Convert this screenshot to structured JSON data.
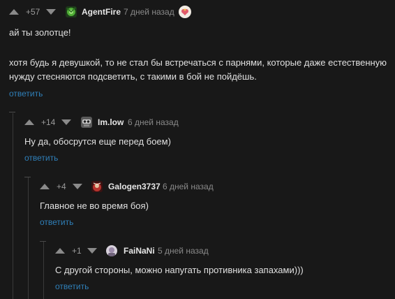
{
  "comments": [
    {
      "rating": "+57",
      "author": "AgentFire",
      "time": "7 дней назад",
      "lines": [
        "ай ты золотце!",
        "",
        "хотя будь я девушкой, то не стал бы встречаться с парнями, которые даже естественную",
        "нужду стесняются подсветить, с такими в бой не пойдёшь."
      ],
      "reply": "ответить"
    },
    {
      "rating": "+14",
      "author": "Im.low",
      "time": "6 дней назад",
      "lines": [
        "Ну да, обосрутся еще перед боем)"
      ],
      "reply": "ответить"
    },
    {
      "rating": "+4",
      "author": "Galogen3737",
      "time": "6 дней назад",
      "lines": [
        "Главное не во время боя)"
      ],
      "reply": "ответить"
    },
    {
      "rating": "+1",
      "author": "FaiNaNi",
      "time": "5 дней назад",
      "lines": [
        "С другой стороны, можно напугать противника запахами)))"
      ],
      "reply": "ответить"
    }
  ],
  "colors": {
    "accent_link": "#2f7fb8",
    "background": "#181818",
    "arrow": "#8a8a8a"
  },
  "icons": {
    "upvote": "triangle-up",
    "downvote": "triangle-down",
    "badge": "heart-flower"
  }
}
